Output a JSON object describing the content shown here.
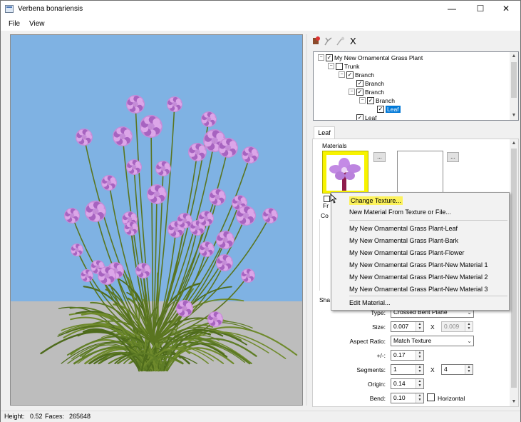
{
  "window": {
    "title": "Verbena bonariensis",
    "minimize_glyph": "—",
    "maximize_glyph": "☐",
    "close_glyph": "✕"
  },
  "menu": {
    "file": "File",
    "view": "View"
  },
  "toolbar": {
    "icons": [
      "add-node-icon",
      "branch-tool-icon",
      "leaf-tool-icon",
      "delete-icon"
    ],
    "delete_glyph": "X"
  },
  "tree": {
    "nodes": [
      {
        "label": "My New Ornamental Grass Plant",
        "checked": true,
        "expander": "−"
      },
      {
        "label": "Trunk",
        "checked": false,
        "expander": "−"
      },
      {
        "label": "Branch",
        "checked": true,
        "expander": "−"
      },
      {
        "label": "Branch",
        "checked": true,
        "expander": ""
      },
      {
        "label": "Branch",
        "checked": true,
        "expander": "−"
      },
      {
        "label": "Branch",
        "checked": true,
        "expander": "−"
      },
      {
        "label": "Leaf",
        "checked": true,
        "expander": "",
        "selected": true
      },
      {
        "label": "Leaf",
        "checked": true,
        "expander": ""
      }
    ]
  },
  "tabs": {
    "active": "Leaf"
  },
  "materials": {
    "group_label": "Materials",
    "dots_label": "...",
    "partial_fr": "Fr",
    "partial_co": "Co",
    "partial_sha": "Sha"
  },
  "shape": {
    "type_label": "Type:",
    "type_value": "Crossed Bent Plane",
    "size_label": "Size:",
    "size_value": "0.007",
    "size_x": "X",
    "size_value2": "0.009",
    "aspect_label": "Aspect Ratio:",
    "aspect_value": "Match Texture",
    "plusminus_label": "+/-:",
    "plusminus_value": "0.17",
    "segments_label": "Segments:",
    "segments_value": "1",
    "segments_x": "X",
    "segments_value2": "4",
    "origin_label": "Origin:",
    "origin_value": "0.14",
    "bend_label": "Bend:",
    "bend_value": "0.10",
    "horizontal_label": "Horizontal"
  },
  "context_menu": {
    "change_texture": "Change Texture...",
    "new_material": "New Material From Texture or File...",
    "materials": [
      "My New Ornamental Grass Plant-Leaf",
      "My New Ornamental Grass Plant-Bark",
      "My New Ornamental Grass Plant-Flower",
      "My New Ornamental Grass Plant-New Material 1",
      "My New Ornamental Grass Plant-New Material 2",
      "My New Ornamental Grass Plant-New Material 3"
    ],
    "checked_index": 2,
    "edit_material": "Edit Material..."
  },
  "status": {
    "height_label": "Height:",
    "height_value": "0.52",
    "faces_label": "Faces:",
    "faces_value": "265648"
  },
  "colors": {
    "sky": "#7fb2e3",
    "ground": "#bdbdbd",
    "flower": "#c98ad8",
    "stem": "#4e6b1c",
    "highlight": "#fcf25c",
    "selection": "#0078d7"
  }
}
